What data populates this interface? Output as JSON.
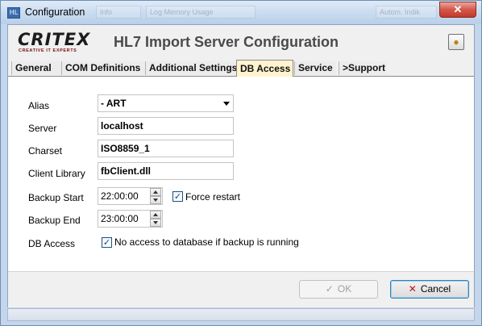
{
  "window": {
    "title": "Configuration",
    "app_icon_text": "HL",
    "close_symbol": "✕"
  },
  "background_ghosts": [
    "Info",
    "Log Memory Usage",
    "Autom. Indik"
  ],
  "header": {
    "logo_main": "CRITEX",
    "logo_sub": "CREATIVE IT EXPERTS",
    "heading": "HL7 Import Server Configuration",
    "help_icon": "help-book-icon"
  },
  "tabs": [
    {
      "label": "General",
      "active": false
    },
    {
      "label": "COM Definitions",
      "active": false
    },
    {
      "label": "Additional Settings",
      "active": false
    },
    {
      "label": "DB Access",
      "active": true
    },
    {
      "label": "Service",
      "active": false
    },
    {
      "label": ">Support",
      "active": false
    }
  ],
  "form": {
    "alias_label": "Alias",
    "alias_value": "- ART",
    "server_label": "Server",
    "server_value": "localhost",
    "charset_label": "Charset",
    "charset_value": "ISO8859_1",
    "client_library_label": "Client Library",
    "client_library_value": "fbClient.dll",
    "backup_start_label": "Backup Start",
    "backup_start_value": "22:00:00",
    "force_restart_label": "Force restart",
    "force_restart_checked": true,
    "backup_end_label": "Backup End",
    "backup_end_value": "23:00:00",
    "db_access_label": "DB Access",
    "no_access_label": "No access to database if backup is running",
    "no_access_checked": true
  },
  "buttons": {
    "ok_label": "OK",
    "ok_icon": "checkmark-icon",
    "cancel_label": "Cancel",
    "cancel_icon": "red-x-icon"
  },
  "colors": {
    "active_tab": "#fff3cf",
    "cancel_icon": "#c0111f",
    "frame": "#c4d6ec"
  }
}
